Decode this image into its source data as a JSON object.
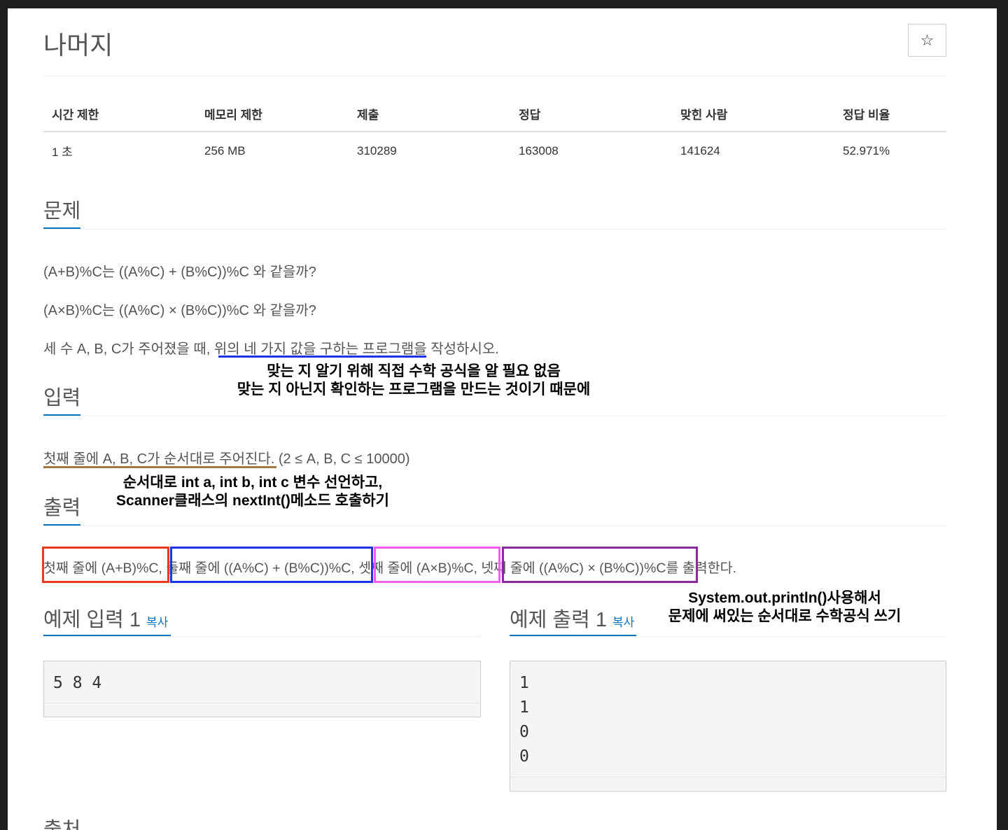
{
  "title": "나머지",
  "star_icon": "☆",
  "stats": {
    "headers": [
      "시간 제한",
      "메모리 제한",
      "제출",
      "정답",
      "맞힌 사람",
      "정답 비율"
    ],
    "values": [
      "1 초",
      "256 MB",
      "310289",
      "163008",
      "141624",
      "52.971%"
    ]
  },
  "problem": {
    "heading": "문제",
    "lines": [
      "(A+B)%C는 ((A%C) + (B%C))%C 와 같을까?",
      "(A×B)%C는 ((A%C) × (B%C))%C 와 같을까?"
    ],
    "line3_pre": "세 수 A, B, C가 주어졌을 때, ",
    "line3_mark": "위의 네 가지 값을 구하는 프로그램",
    "line3_post": "을 작성하시오.",
    "annotation": [
      "맞는 지 알기 위해 직접 수학 공식을 알 필요 없음",
      "맞는 지 아닌지 확인하는 프로그램을 만드는 것이기 때문에"
    ]
  },
  "input": {
    "heading": "입력",
    "line_mark": "첫째 줄에 A, B, C가 순서대로 주어진다.",
    "line_post": " (2 ≤ A, B, C ≤ 10000)",
    "annotation": [
      "순서대로 int a, int b, int c 변수 선언하고,",
      "Scanner클래스의 nextInt()메소드 호출하기"
    ]
  },
  "output": {
    "heading": "출력",
    "part1": "첫째 줄에 (A+B)%C,",
    "part2": "둘째 줄에 ((A%C) + (B%C))%C,",
    "part3": "셋째 줄에 (A×B)%C,",
    "part4": "넷째 줄에 ((A%C) × (B%C))%C",
    "part5": "를 출력한다.",
    "annotation": [
      "System.out.println()사용해서",
      "문제에 써있는 순서대로 수학공식 쓰기"
    ]
  },
  "sample_input": {
    "heading": "예제 입력 1",
    "copy": "복사",
    "content": "5 8 4"
  },
  "sample_output": {
    "heading": "예제 출력 1",
    "copy": "복사",
    "content": "1\n1\n0\n0"
  },
  "source_heading": "출처",
  "colors": {
    "accent": "#0076c0",
    "box1": "#ee3a1c",
    "box2": "#1a35e8",
    "box3": "#f45cf2",
    "box4": "#8a2aa0",
    "underline_problem": "#1a35e8",
    "underline_input": "#a07840"
  }
}
